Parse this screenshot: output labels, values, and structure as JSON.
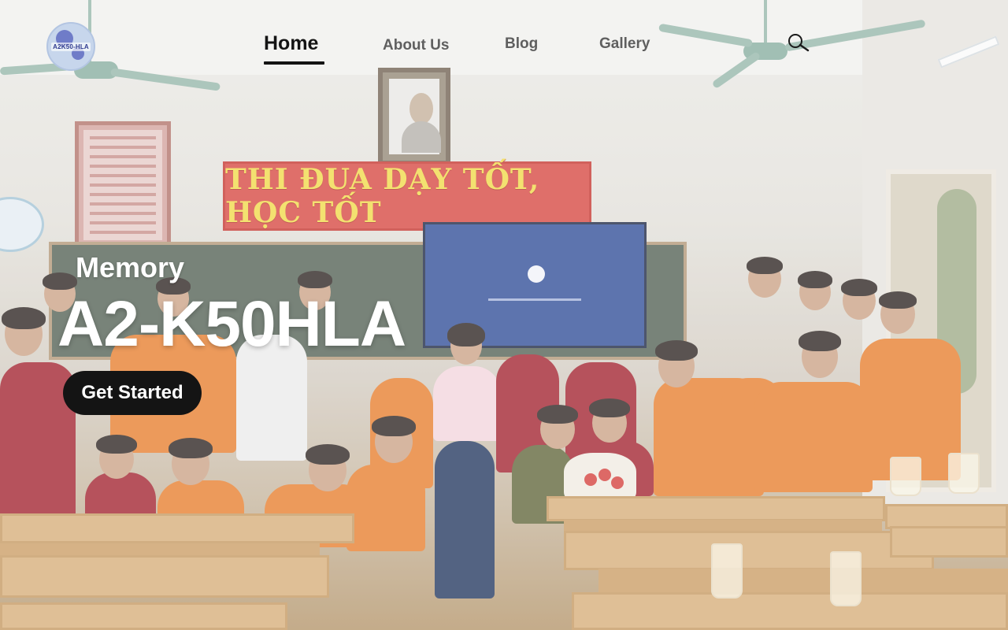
{
  "logo": {
    "text": "A2K50-HLA"
  },
  "nav": {
    "items": [
      {
        "label": "Home",
        "active": true
      },
      {
        "label": "About Us",
        "active": false
      },
      {
        "label": "Blog",
        "active": false
      },
      {
        "label": "Gallery",
        "active": false
      }
    ],
    "search_icon": "search-icon"
  },
  "hero": {
    "eyebrow": "Memory",
    "title": "A2-K50HLA",
    "cta_label": "Get Started",
    "background": {
      "banner_text": "THI ĐUA DẠY TỐT, HỌC TỐT"
    }
  },
  "colors": {
    "text_active": "#141414",
    "text_muted": "#5f5f5f",
    "hero_text": "#ffffff",
    "cta_background": "#141414",
    "banner_red": "#d9544e",
    "banner_text": "#f1dc55",
    "uniform_orange": "#e9873c",
    "uniform_maroon": "#a8323d"
  }
}
